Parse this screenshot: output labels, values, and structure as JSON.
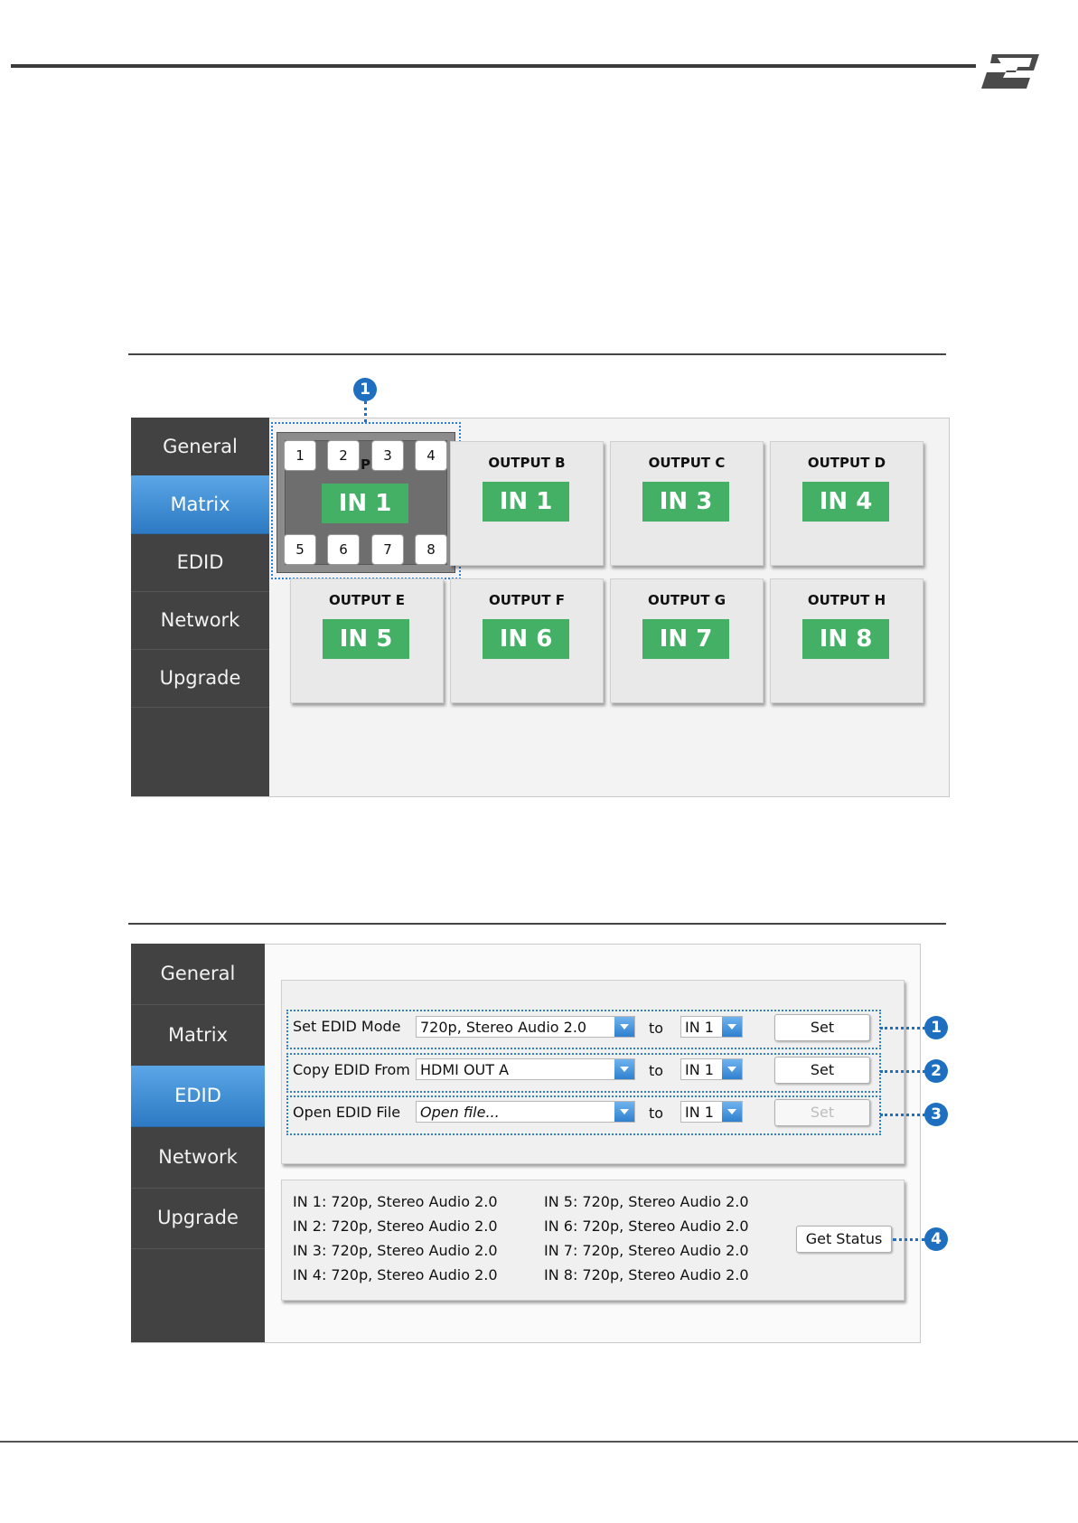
{
  "callout_numbers": [
    "1",
    "2",
    "3",
    "4"
  ],
  "matrix_panel": {
    "nav": [
      "General",
      "Matrix",
      "EDID",
      "Network",
      "Upgrade"
    ],
    "active_nav": "Matrix",
    "output_a": {
      "title_fragment": "PU",
      "value": "IN 1",
      "input_buttons_top": [
        "1",
        "2",
        "3",
        "4"
      ],
      "input_buttons_bottom": [
        "5",
        "6",
        "7",
        "8"
      ]
    },
    "outputs": [
      {
        "title": "OUTPUT B",
        "value": "IN 1"
      },
      {
        "title": "OUTPUT C",
        "value": "IN 3"
      },
      {
        "title": "OUTPUT D",
        "value": "IN 4"
      },
      {
        "title": "OUTPUT E",
        "value": "IN 5"
      },
      {
        "title": "OUTPUT F",
        "value": "IN 6"
      },
      {
        "title": "OUTPUT G",
        "value": "IN 7"
      },
      {
        "title": "OUTPUT H",
        "value": "IN 8"
      }
    ],
    "badge_color": "#43b065",
    "active_nav_color": "#2d7ac4"
  },
  "edid_panel": {
    "nav": [
      "General",
      "Matrix",
      "EDID",
      "Network",
      "Upgrade"
    ],
    "active_nav": "EDID",
    "rows": [
      {
        "label": "Set EDID Mode",
        "source": "720p, Stereo Audio 2.0",
        "to": "to",
        "target": "IN 1",
        "button": "Set",
        "enabled": true
      },
      {
        "label": "Copy EDID From",
        "source": "HDMI OUT A",
        "to": "to",
        "target": "IN 1",
        "button": "Set",
        "enabled": true
      },
      {
        "label": "Open EDID File",
        "source": "Open file...",
        "to": "to",
        "target": "IN 1",
        "button": "Set",
        "enabled": false
      }
    ],
    "status_left": [
      "IN 1: 720p, Stereo Audio 2.0",
      "IN 2: 720p, Stereo Audio 2.0",
      "IN 3: 720p, Stereo Audio 2.0",
      "IN 4: 720p, Stereo Audio 2.0"
    ],
    "status_right": [
      "IN 5: 720p, Stereo Audio 2.0",
      "IN 6: 720p, Stereo Audio 2.0",
      "IN 7: 720p, Stereo Audio 2.0",
      "IN 8: 720p, Stereo Audio 2.0"
    ],
    "get_status_button": "Get Status"
  }
}
